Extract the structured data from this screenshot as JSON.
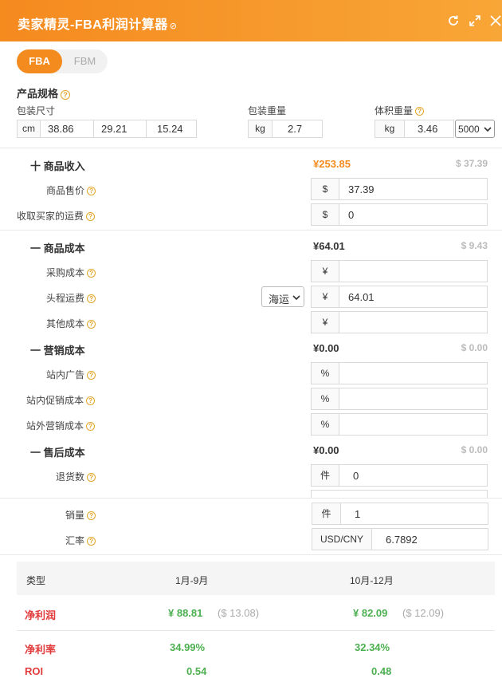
{
  "header": {
    "title": "卖家精灵-FBA利润计算器",
    "link_glyph": "⊘"
  },
  "tabs": {
    "fba": "FBA",
    "fbm": "FBM"
  },
  "spec": {
    "title": "产品规格",
    "size_label": "包装尺寸",
    "size_unit": "cm",
    "length": "38.86",
    "width": "29.21",
    "height": "15.24",
    "weight_label": "包装重量",
    "weight_unit": "kg",
    "weight": "2.7",
    "volume_label": "体积重量",
    "volume_unit": "kg",
    "volume": "3.46",
    "divisor": "5000"
  },
  "income": {
    "title": "十 商品收入",
    "cny": "¥253.85",
    "usd": "$ 37.39",
    "price_label": "商品售价",
    "price_unit": "$",
    "price": "37.39",
    "shipping_label": "收取买家的运费",
    "shipping_unit": "$",
    "shipping": "0"
  },
  "product_cost": {
    "title": "一 商品成本",
    "cny": "¥64.01",
    "usd": "$ 9.43",
    "purchase_label": "采购成本",
    "purchase_unit": "¥",
    "purchase": "",
    "freight_label": "头程运费",
    "freight_mode": "海运",
    "freight_unit": "¥",
    "freight": "64.01",
    "other_label": "其他成本",
    "other_unit": "¥",
    "other": ""
  },
  "marketing": {
    "title": "一 营销成本",
    "cny": "¥0.00",
    "usd": "$ 0.00",
    "ads_label": "站内广告",
    "promo_label": "站内促销成本",
    "external_label": "站外营销成本",
    "unit": "%"
  },
  "after_sale": {
    "title": "一 售后成本",
    "cny": "¥0.00",
    "usd": "$ 0.00",
    "returns_label": "退货数",
    "returns_unit": "件",
    "returns": "0"
  },
  "sales": {
    "qty_label": "销量",
    "qty_unit": "件",
    "qty": "1",
    "rate_label": "汇率",
    "rate_unit": "USD/CNY",
    "rate": "6.7892"
  },
  "results": {
    "col_type": "类型",
    "col_q1": "1月-9月",
    "col_q2": "10月-12月",
    "profit_label": "净利润",
    "profit_q1_cny": "¥ 88.81",
    "profit_q1_usd": "($ 13.08)",
    "profit_q2_cny": "¥ 82.09",
    "profit_q2_usd": "($ 12.09)",
    "margin_label": "净利率",
    "margin_q1": "34.99%",
    "margin_q2": "32.34%",
    "roi_label": "ROI",
    "roi_q1": "0.54",
    "roi_q2": "0.48"
  },
  "colors": {
    "accent": "#f38b1f",
    "profit_red": "#e23b3b",
    "profit_green": "#4caf50"
  }
}
